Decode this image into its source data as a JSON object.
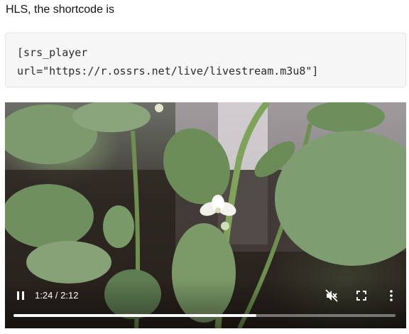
{
  "intro_text": "HLS, the shortcode is",
  "code": {
    "line1": "[srs_player",
    "line2": "url=\"https://r.ossrs.net/live/livestream.m3u8\"]"
  },
  "video": {
    "time_display": "1:24 / 2:12",
    "progress_fraction": 0.636,
    "controls": {
      "play_icon": "pause-icon",
      "mute_icon": "volume-muted-icon",
      "fullscreen_icon": "fullscreen-icon",
      "more_icon": "more-vertical-icon"
    }
  }
}
